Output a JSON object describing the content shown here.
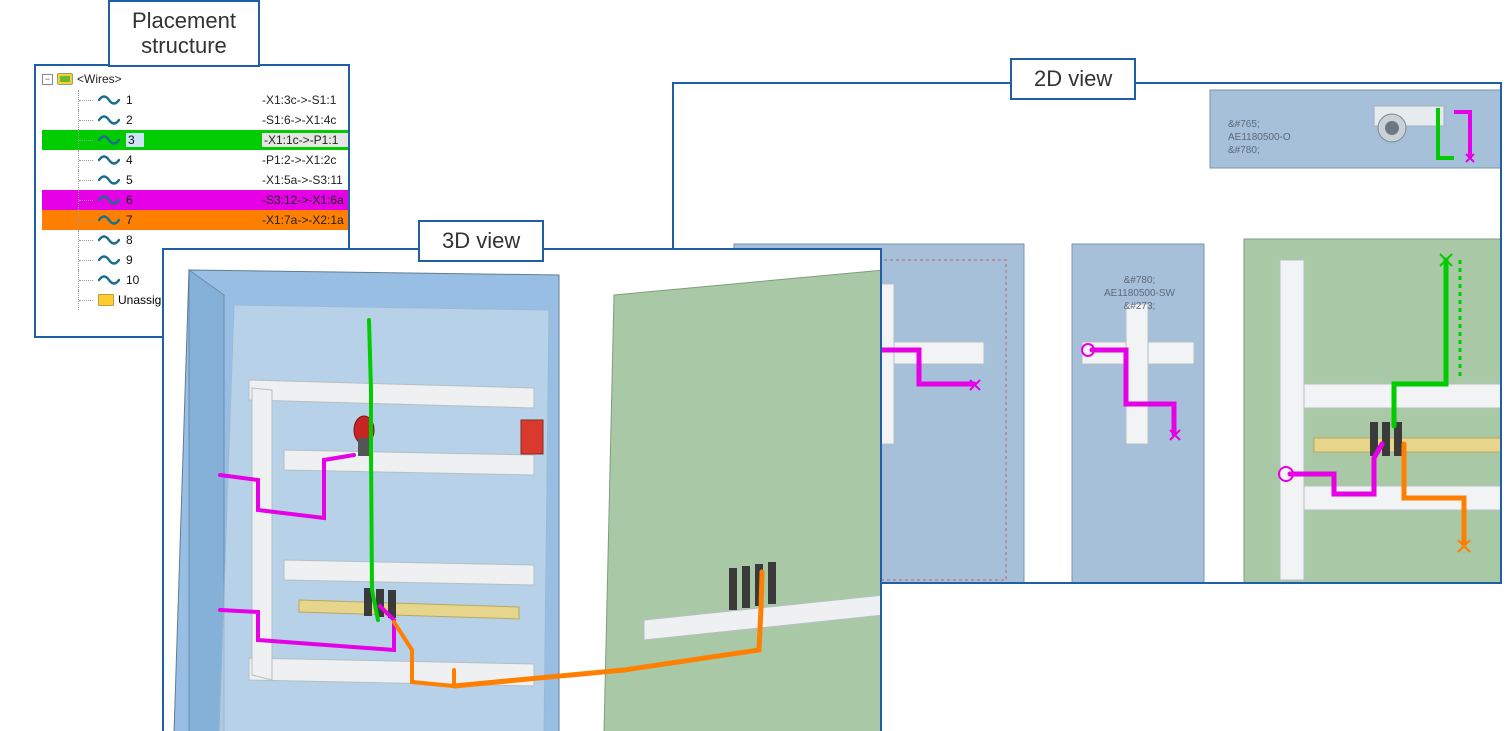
{
  "labels": {
    "placement_structure": "Placement\nstructure",
    "view3d": "3D view",
    "view2d": "2D view"
  },
  "tree": {
    "root_expander": "−",
    "root_label": "<Wires>",
    "rows": [
      {
        "num": "1",
        "desc": "-X1:3c->-S1:1",
        "highlight": ""
      },
      {
        "num": "2",
        "desc": "-S1:6->-X1:4c",
        "highlight": ""
      },
      {
        "num": "3",
        "desc": "-X1:1c->-P1:1",
        "highlight": "green",
        "selected": true
      },
      {
        "num": "4",
        "desc": "-P1:2->-X1:2c",
        "highlight": ""
      },
      {
        "num": "5",
        "desc": "-X1:5a->-S3:11",
        "highlight": ""
      },
      {
        "num": "6",
        "desc": "-S3:12->-X1:6a",
        "highlight": "magenta"
      },
      {
        "num": "7",
        "desc": "-X1:7a->-X2:1a",
        "highlight": "orange"
      },
      {
        "num": "8",
        "desc": "",
        "highlight": ""
      },
      {
        "num": "9",
        "desc": "",
        "highlight": ""
      },
      {
        "num": "10",
        "desc": "",
        "highlight": ""
      }
    ],
    "unassigned_label": "Unassign"
  },
  "view2d": {
    "panel_top_text": "&#765;\nAE1180500-O\n&#780;",
    "panel_mid_text": "&#780;\nAE1180500-SW\n&#273;"
  },
  "colors": {
    "frame": "#1f5fa8",
    "green": "#00cc00",
    "magenta": "#e600e6",
    "orange": "#ff7f00"
  }
}
